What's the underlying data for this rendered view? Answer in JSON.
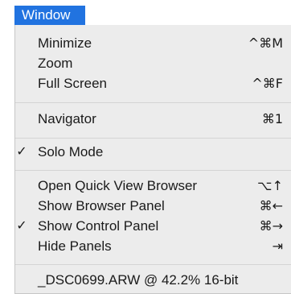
{
  "menubar": {
    "title": "Window"
  },
  "menu": {
    "groups": [
      {
        "items": [
          {
            "label": "Minimize",
            "shortcut": "^⌘M",
            "checked": ""
          },
          {
            "label": "Zoom",
            "shortcut": "",
            "checked": ""
          },
          {
            "label": "Full Screen",
            "shortcut": "^⌘F",
            "checked": ""
          }
        ]
      },
      {
        "items": [
          {
            "label": "Navigator",
            "shortcut": "⌘1",
            "checked": ""
          }
        ]
      },
      {
        "items": [
          {
            "label": "Solo Mode",
            "shortcut": "",
            "checked": "✓"
          }
        ]
      },
      {
        "items": [
          {
            "label": "Open Quick View Browser",
            "shortcut": "⌥↑",
            "checked": ""
          },
          {
            "label": "Show Browser Panel",
            "shortcut": "⌘←",
            "checked": ""
          },
          {
            "label": "Show Control Panel",
            "shortcut": "⌘→",
            "checked": "✓"
          },
          {
            "label": "Hide Panels",
            "shortcut": "⇥",
            "checked": ""
          }
        ]
      },
      {
        "items": [
          {
            "label": "_DSC0699.ARW @ 42.2% 16-bit",
            "shortcut": "",
            "checked": ""
          }
        ]
      }
    ]
  },
  "colors": {
    "menu_title_bg": "#2173e0",
    "menu_bg": "#ececec",
    "separator": "#d4d4d4"
  }
}
